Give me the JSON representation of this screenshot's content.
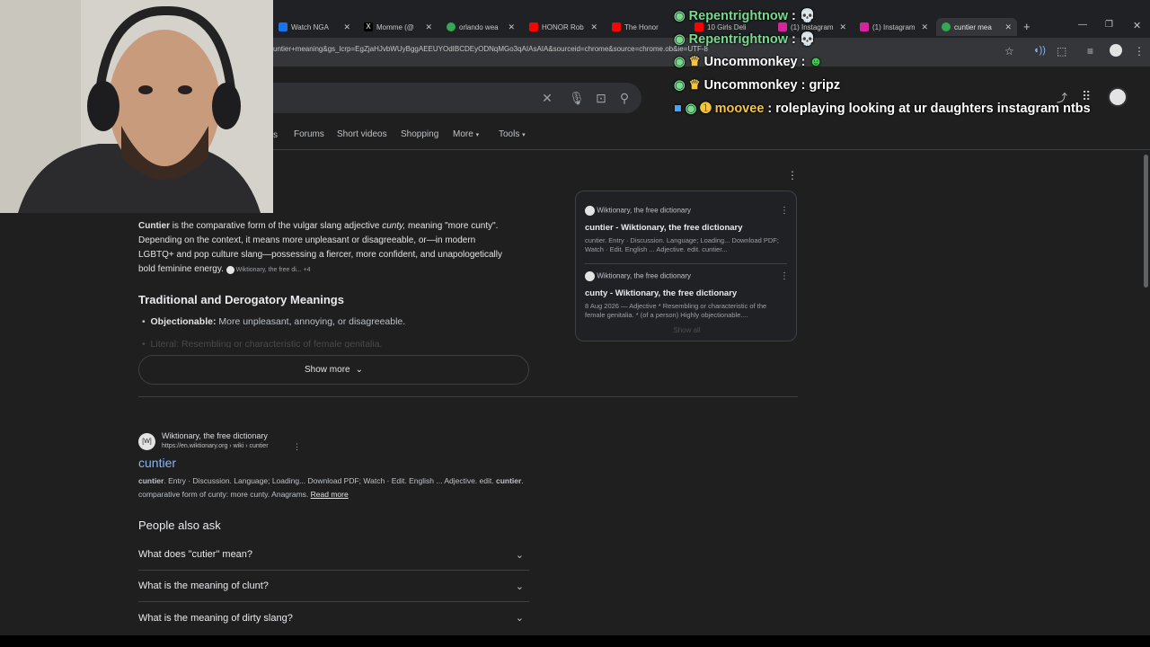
{
  "browser": {
    "tabs": [
      {
        "label": "Watch NGA",
        "fav": "#1a73e8"
      },
      {
        "label": "Momme (@",
        "fav": "#000000"
      },
      {
        "label": "orlando wea",
        "fav": "#34a853"
      },
      {
        "label": "HONOR Rob",
        "fav": "#ff0000"
      },
      {
        "label": "The Honor",
        "fav": "#ff0000"
      },
      {
        "label": "10 Girls Deli",
        "fav": "#ff0000"
      },
      {
        "label": "(1) Instagram",
        "fav": "#d6249f"
      },
      {
        "label": "(1) Instagram",
        "fav": "#d6249f"
      },
      {
        "label": "cuntier mea",
        "fav": "#34a853"
      }
    ],
    "url": "untier+meaning&gs_lcrp=EgZjaHJvbWUyBggAEEUYOdIBCDEyODNqMGo3qAIAsAIA&sourceid=chrome&source=chrome.ob&ie=UTF-8"
  },
  "search": {
    "nav": [
      "Forums",
      "Short videos",
      "Shopping",
      "More",
      "Tools"
    ]
  },
  "overview": {
    "term": "Cuntier",
    "text1": " is the comparative form of the vulgar slang adjective ",
    "italic": "cunty,",
    "text2": " meaning \"more cunty\". Depending on the context, it means more unpleasant or disagreeable, or—in modern LGBTQ+ and pop culture slang—possessing a fiercer, more confident, and unapologetically bold feminine energy.",
    "source_chip": "Wiktionary, the free di...",
    "source_more": "+4",
    "heading": "Traditional and Derogatory Meanings",
    "bullet1_label": "Objectionable:",
    "bullet1_text": " More unpleasant, annoying, or disagreeable.",
    "bullet2_faded": "Literal: Resembling or characteristic of female genitalia.",
    "show_more": "Show more"
  },
  "sources_card": {
    "items": [
      {
        "site": "Wiktionary, the free dictionary",
        "title": "cuntier - Wiktionary, the free dictionary",
        "snippet": "cuntier. Entry · Discussion. Language; Loading... Download PDF; Watch · Edit. English ... Adjective. edit. cuntier..."
      },
      {
        "site": "Wiktionary, the free dictionary",
        "title": "cunty - Wiktionary, the free dictionary",
        "snippet": "8 Aug 2026 — Adjective * Resembling or characteristic of the female genitalia. * (of a person) Highly objectionable...."
      }
    ],
    "show_all": "Show all"
  },
  "result": {
    "site": "Wiktionary, the free dictionary",
    "cite": "https://en.wiktionary.org › wiki › cuntier",
    "title": "cuntier",
    "snippet_a": "cuntier",
    "snippet_b": ". Entry · Discussion. Language; Loading... Download PDF; Watch · Edit. English ... Adjective. edit. ",
    "snippet_c": "cuntier",
    "snippet_d": ". comparative form of cunty: more cunty. Anagrams. ",
    "read_more": "Read more"
  },
  "paa": {
    "heading": "People also ask",
    "questions": [
      "What does \"cutier\" mean?",
      "What is the meaning of clunt?",
      "What is the meaning of dirty slang?"
    ]
  },
  "chat": [
    {
      "user": "Repentrightnow",
      "msg": "",
      "color": "#7bd88f",
      "emote": "skull"
    },
    {
      "user": "Repentrightnow",
      "msg": "",
      "color": "#7bd88f",
      "emote": "skull"
    },
    {
      "user": "Uncommonkey",
      "msg": "",
      "color": "#ffffff",
      "emote": "green-face"
    },
    {
      "user": "Uncommonkey",
      "msg": "gripz",
      "color": "#ffffff",
      "emote": ""
    },
    {
      "user": "moovee",
      "msg": "roleplaying looking at ur daughters instagram ntbs",
      "color": "#f5c542",
      "emote": ""
    }
  ]
}
